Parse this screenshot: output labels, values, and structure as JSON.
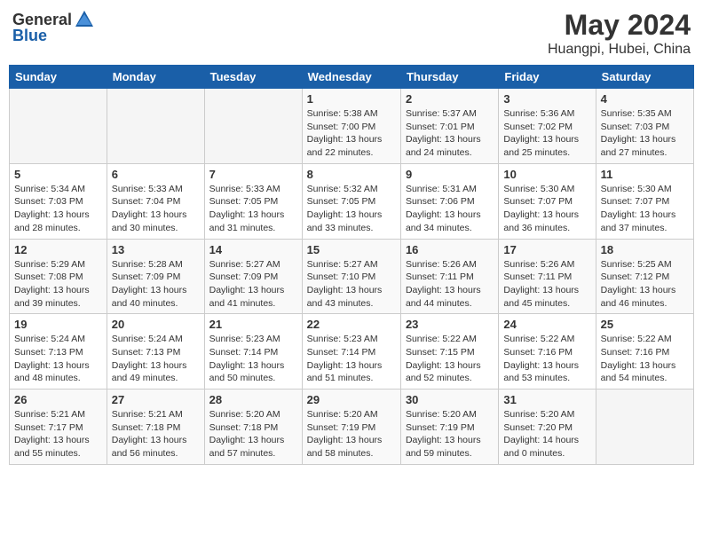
{
  "header": {
    "logo_general": "General",
    "logo_blue": "Blue",
    "title": "May 2024",
    "location": "Huangpi, Hubei, China"
  },
  "calendar": {
    "days_of_week": [
      "Sunday",
      "Monday",
      "Tuesday",
      "Wednesday",
      "Thursday",
      "Friday",
      "Saturday"
    ],
    "weeks": [
      [
        {
          "day": "",
          "sunrise": "",
          "sunset": "",
          "daylight": ""
        },
        {
          "day": "",
          "sunrise": "",
          "sunset": "",
          "daylight": ""
        },
        {
          "day": "",
          "sunrise": "",
          "sunset": "",
          "daylight": ""
        },
        {
          "day": "1",
          "sunrise": "Sunrise: 5:38 AM",
          "sunset": "Sunset: 7:00 PM",
          "daylight": "Daylight: 13 hours and 22 minutes."
        },
        {
          "day": "2",
          "sunrise": "Sunrise: 5:37 AM",
          "sunset": "Sunset: 7:01 PM",
          "daylight": "Daylight: 13 hours and 24 minutes."
        },
        {
          "day": "3",
          "sunrise": "Sunrise: 5:36 AM",
          "sunset": "Sunset: 7:02 PM",
          "daylight": "Daylight: 13 hours and 25 minutes."
        },
        {
          "day": "4",
          "sunrise": "Sunrise: 5:35 AM",
          "sunset": "Sunset: 7:03 PM",
          "daylight": "Daylight: 13 hours and 27 minutes."
        }
      ],
      [
        {
          "day": "5",
          "sunrise": "Sunrise: 5:34 AM",
          "sunset": "Sunset: 7:03 PM",
          "daylight": "Daylight: 13 hours and 28 minutes."
        },
        {
          "day": "6",
          "sunrise": "Sunrise: 5:33 AM",
          "sunset": "Sunset: 7:04 PM",
          "daylight": "Daylight: 13 hours and 30 minutes."
        },
        {
          "day": "7",
          "sunrise": "Sunrise: 5:33 AM",
          "sunset": "Sunset: 7:05 PM",
          "daylight": "Daylight: 13 hours and 31 minutes."
        },
        {
          "day": "8",
          "sunrise": "Sunrise: 5:32 AM",
          "sunset": "Sunset: 7:05 PM",
          "daylight": "Daylight: 13 hours and 33 minutes."
        },
        {
          "day": "9",
          "sunrise": "Sunrise: 5:31 AM",
          "sunset": "Sunset: 7:06 PM",
          "daylight": "Daylight: 13 hours and 34 minutes."
        },
        {
          "day": "10",
          "sunrise": "Sunrise: 5:30 AM",
          "sunset": "Sunset: 7:07 PM",
          "daylight": "Daylight: 13 hours and 36 minutes."
        },
        {
          "day": "11",
          "sunrise": "Sunrise: 5:30 AM",
          "sunset": "Sunset: 7:07 PM",
          "daylight": "Daylight: 13 hours and 37 minutes."
        }
      ],
      [
        {
          "day": "12",
          "sunrise": "Sunrise: 5:29 AM",
          "sunset": "Sunset: 7:08 PM",
          "daylight": "Daylight: 13 hours and 39 minutes."
        },
        {
          "day": "13",
          "sunrise": "Sunrise: 5:28 AM",
          "sunset": "Sunset: 7:09 PM",
          "daylight": "Daylight: 13 hours and 40 minutes."
        },
        {
          "day": "14",
          "sunrise": "Sunrise: 5:27 AM",
          "sunset": "Sunset: 7:09 PM",
          "daylight": "Daylight: 13 hours and 41 minutes."
        },
        {
          "day": "15",
          "sunrise": "Sunrise: 5:27 AM",
          "sunset": "Sunset: 7:10 PM",
          "daylight": "Daylight: 13 hours and 43 minutes."
        },
        {
          "day": "16",
          "sunrise": "Sunrise: 5:26 AM",
          "sunset": "Sunset: 7:11 PM",
          "daylight": "Daylight: 13 hours and 44 minutes."
        },
        {
          "day": "17",
          "sunrise": "Sunrise: 5:26 AM",
          "sunset": "Sunset: 7:11 PM",
          "daylight": "Daylight: 13 hours and 45 minutes."
        },
        {
          "day": "18",
          "sunrise": "Sunrise: 5:25 AM",
          "sunset": "Sunset: 7:12 PM",
          "daylight": "Daylight: 13 hours and 46 minutes."
        }
      ],
      [
        {
          "day": "19",
          "sunrise": "Sunrise: 5:24 AM",
          "sunset": "Sunset: 7:13 PM",
          "daylight": "Daylight: 13 hours and 48 minutes."
        },
        {
          "day": "20",
          "sunrise": "Sunrise: 5:24 AM",
          "sunset": "Sunset: 7:13 PM",
          "daylight": "Daylight: 13 hours and 49 minutes."
        },
        {
          "day": "21",
          "sunrise": "Sunrise: 5:23 AM",
          "sunset": "Sunset: 7:14 PM",
          "daylight": "Daylight: 13 hours and 50 minutes."
        },
        {
          "day": "22",
          "sunrise": "Sunrise: 5:23 AM",
          "sunset": "Sunset: 7:14 PM",
          "daylight": "Daylight: 13 hours and 51 minutes."
        },
        {
          "day": "23",
          "sunrise": "Sunrise: 5:22 AM",
          "sunset": "Sunset: 7:15 PM",
          "daylight": "Daylight: 13 hours and 52 minutes."
        },
        {
          "day": "24",
          "sunrise": "Sunrise: 5:22 AM",
          "sunset": "Sunset: 7:16 PM",
          "daylight": "Daylight: 13 hours and 53 minutes."
        },
        {
          "day": "25",
          "sunrise": "Sunrise: 5:22 AM",
          "sunset": "Sunset: 7:16 PM",
          "daylight": "Daylight: 13 hours and 54 minutes."
        }
      ],
      [
        {
          "day": "26",
          "sunrise": "Sunrise: 5:21 AM",
          "sunset": "Sunset: 7:17 PM",
          "daylight": "Daylight: 13 hours and 55 minutes."
        },
        {
          "day": "27",
          "sunrise": "Sunrise: 5:21 AM",
          "sunset": "Sunset: 7:18 PM",
          "daylight": "Daylight: 13 hours and 56 minutes."
        },
        {
          "day": "28",
          "sunrise": "Sunrise: 5:20 AM",
          "sunset": "Sunset: 7:18 PM",
          "daylight": "Daylight: 13 hours and 57 minutes."
        },
        {
          "day": "29",
          "sunrise": "Sunrise: 5:20 AM",
          "sunset": "Sunset: 7:19 PM",
          "daylight": "Daylight: 13 hours and 58 minutes."
        },
        {
          "day": "30",
          "sunrise": "Sunrise: 5:20 AM",
          "sunset": "Sunset: 7:19 PM",
          "daylight": "Daylight: 13 hours and 59 minutes."
        },
        {
          "day": "31",
          "sunrise": "Sunrise: 5:20 AM",
          "sunset": "Sunset: 7:20 PM",
          "daylight": "Daylight: 14 hours and 0 minutes."
        },
        {
          "day": "",
          "sunrise": "",
          "sunset": "",
          "daylight": ""
        }
      ]
    ]
  }
}
